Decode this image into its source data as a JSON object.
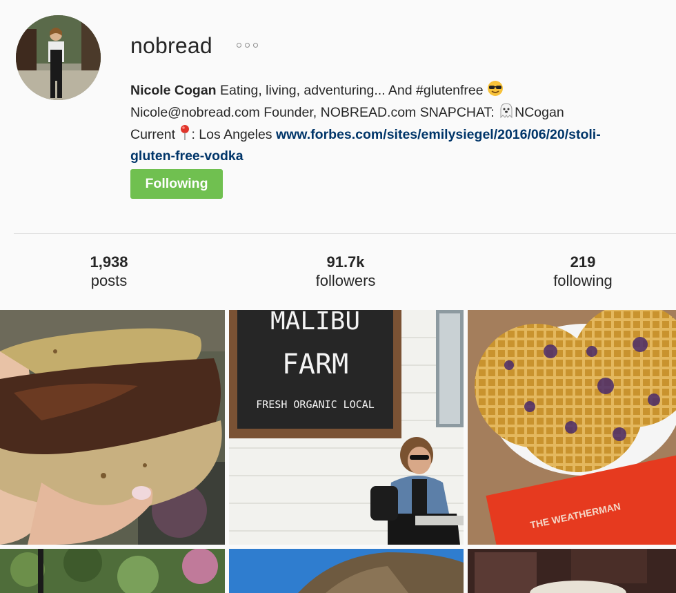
{
  "profile": {
    "username": "nobread",
    "full_name": "Nicole Cogan",
    "bio_line1_text": " Eating, living, adventuring... And #glutenfree ",
    "bio_line2_text": "Nicole@nobread.com Founder, NOBREAD.com SNAPCHAT: ",
    "snapchat_handle": "NCogan",
    "bio_line3_prefix": "Current ",
    "location_text": ": Los Angeles ",
    "website": "www.forbes.com/sites/emilysiegel/2016/06/20/stoli-gluten-free-vodka",
    "website_part1": "www.forbes.com/sites/emilysiegel/2016/06/20/stoli-",
    "website_part2": "gluten-free-vodka"
  },
  "actions": {
    "follow_label": "Following"
  },
  "stats": {
    "posts_count": "1,938",
    "posts_label": "posts",
    "followers_count": "91.7k",
    "followers_label": "followers",
    "following_count": "219",
    "following_label": "following"
  },
  "posts": {
    "sign_line1": "MALIBU",
    "sign_line2": "FARM",
    "sign_line3": "FRESH ORGANIC LOCAL",
    "book_title": "THE WEATHERMAN"
  },
  "colors": {
    "follow_button": "#70c050",
    "link": "#003569",
    "divider": "#dbdbdb"
  }
}
